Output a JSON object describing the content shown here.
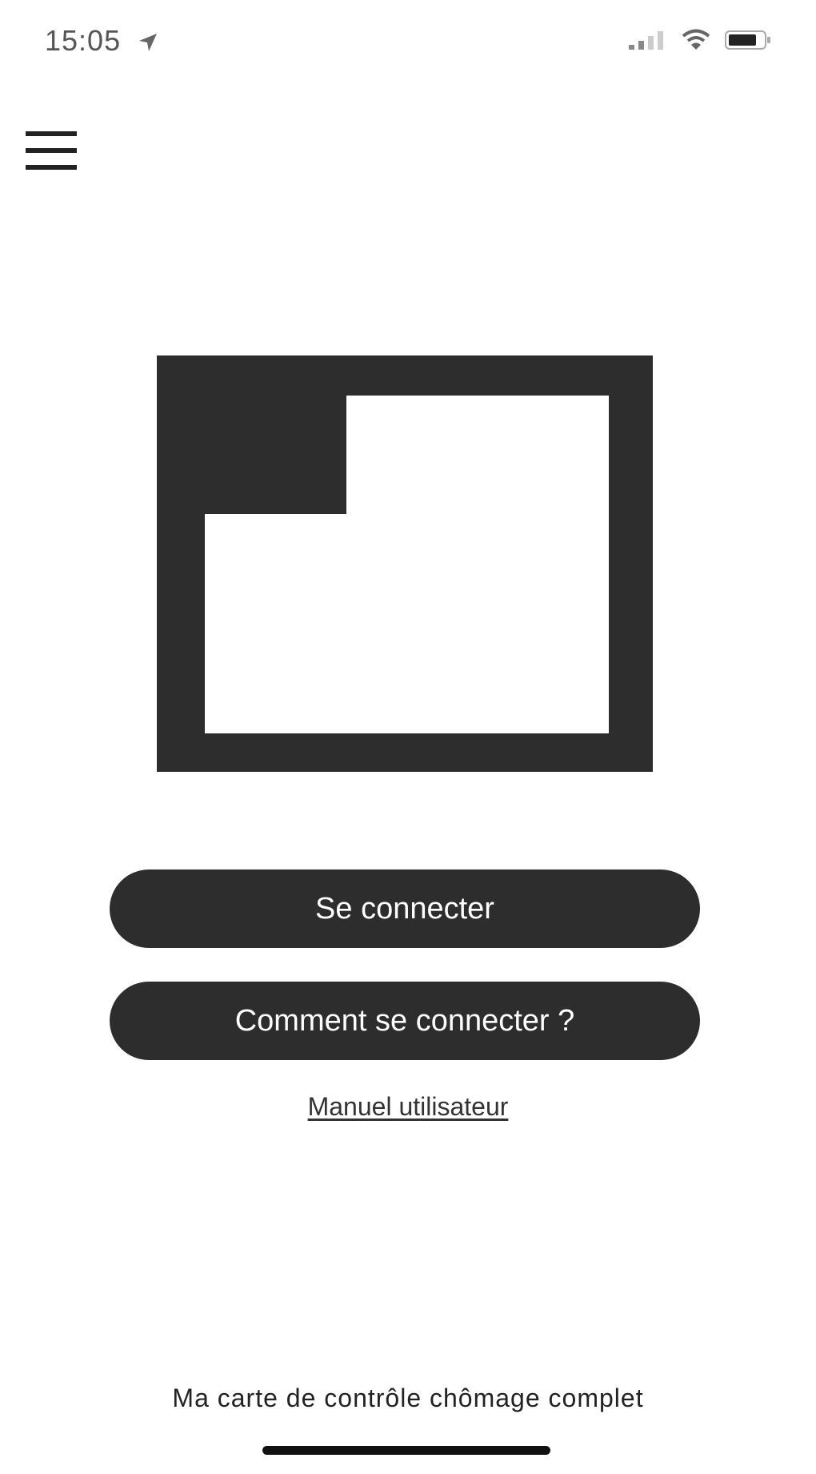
{
  "status_bar": {
    "time": "15:05",
    "icons": [
      "location-arrow-icon",
      "cellular-signal-icon",
      "wifi-icon",
      "battery-icon"
    ]
  },
  "header": {
    "menu_icon": "hamburger-menu-icon"
  },
  "main": {
    "logo_icon": "app-logo-icon",
    "login_button_label": "Se connecter",
    "how_to_button_label": "Comment se connecter ?",
    "manual_link_label": "Manuel utilisateur"
  },
  "footer": {
    "title": "Ma carte de contrôle chômage complet"
  },
  "colors": {
    "primary": "#2d2d2d",
    "background": "#ffffff",
    "button_text": "#ffffff"
  }
}
